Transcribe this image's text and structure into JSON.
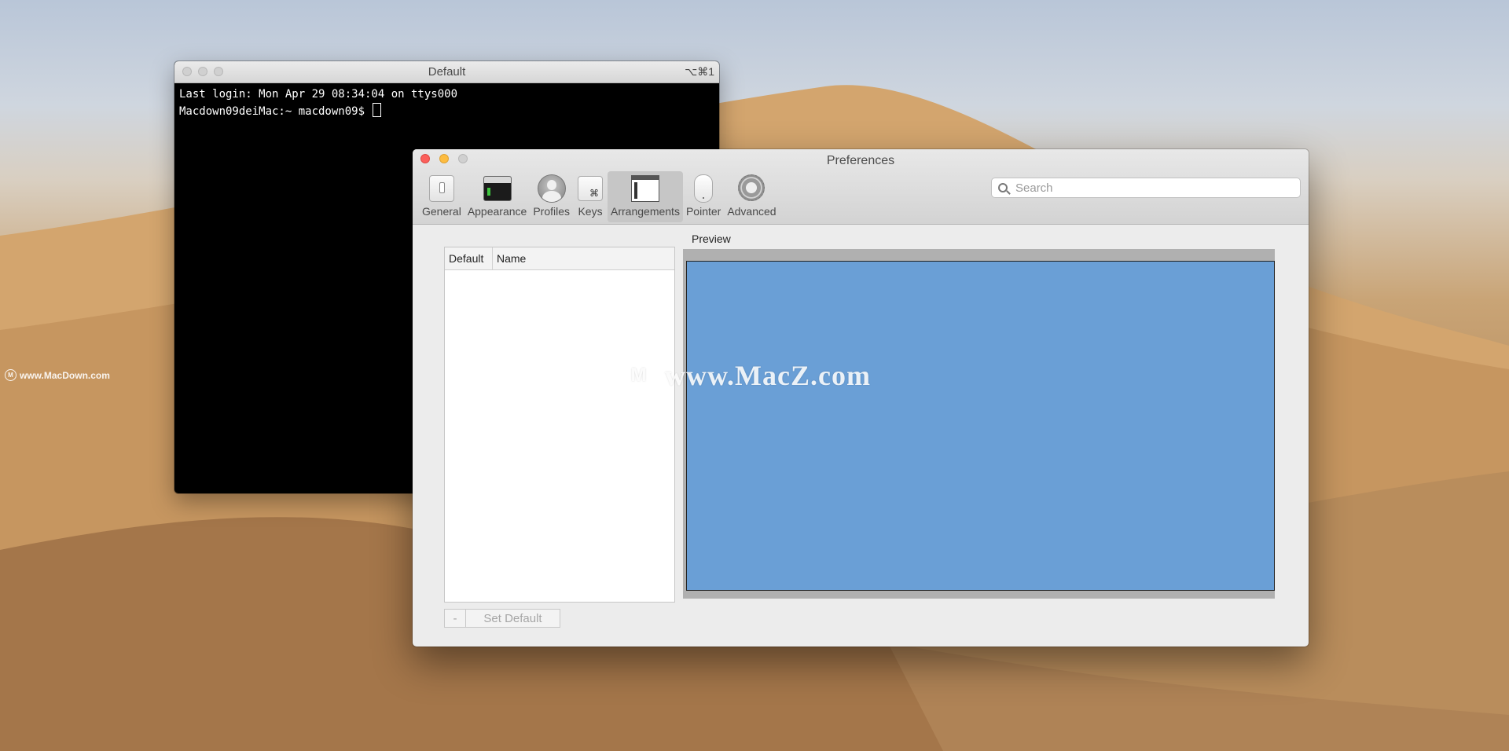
{
  "desktop": {
    "watermark_left": "www.MacDown.com",
    "watermark_center": "www.MacZ.com",
    "wallpaper_colors": [
      "#b9c6d8",
      "#c9a476",
      "#a77d52"
    ]
  },
  "terminal": {
    "title": "Default",
    "shortcut": "⌥⌘1",
    "lines": [
      "Last login: Mon Apr 29 08:34:04 on ttys000",
      "Macdown09deiMac:~ macdown09$ "
    ]
  },
  "preferences": {
    "title": "Preferences",
    "toolbar": [
      {
        "label": "General",
        "icon": "switch-icon"
      },
      {
        "label": "Appearance",
        "icon": "terminal-window-icon"
      },
      {
        "label": "Profiles",
        "icon": "user-icon"
      },
      {
        "label": "Keys",
        "icon": "command-key-icon"
      },
      {
        "label": "Arrangements",
        "icon": "window-arrangement-icon",
        "selected": true
      },
      {
        "label": "Pointer",
        "icon": "mouse-icon"
      },
      {
        "label": "Advanced",
        "icon": "gear-icon"
      }
    ],
    "search": {
      "placeholder": "Search",
      "value": ""
    },
    "table": {
      "columns": [
        "Default",
        "Name"
      ],
      "rows": []
    },
    "buttons": {
      "remove": "-",
      "set_default": "Set Default"
    },
    "preview": {
      "label": "Preview",
      "screen_color": "#6a9fd6"
    }
  }
}
